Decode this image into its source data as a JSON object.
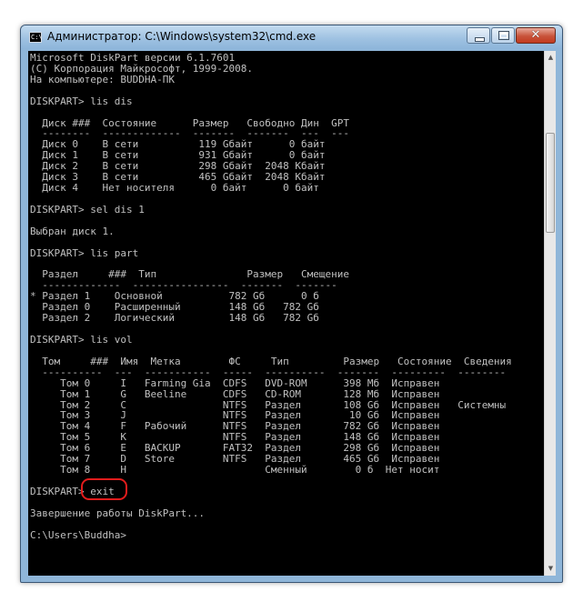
{
  "window": {
    "title": "Администратор: C:\\Windows\\system32\\cmd.exe",
    "close_glyph": "✕"
  },
  "console": {
    "lines": [
      "Microsoft DiskPart версии 6.1.7601",
      "(C) Корпорация Майкрософт, 1999-2008.",
      "На компьютере: BUDDHA-ПК",
      "",
      "DISKPART> lis dis",
      "",
      "  Диск ###  Состояние      Размер   Свободно Дин  GPT",
      "  --------  -------------  -------  -------  ---  ---",
      "  Диск 0    В сети          119 Gбайт      0 байт",
      "  Диск 1    В сети          931 Gбайт      0 байт",
      "  Диск 2    В сети          298 Gбайт  2048 Кбайт",
      "  Диск 3    В сети          465 Gбайт  2048 Кбайт",
      "  Диск 4    Нет носителя      0 байт      0 байт",
      "",
      "DISKPART> sel dis 1",
      "",
      "Выбран диск 1.",
      "",
      "DISKPART> lis part",
      "",
      "  Раздел     ###  Тип               Размер   Смещение",
      "  -------------  ----------------  -------  -------",
      "* Раздел 1    Основной           782 Gб      0 б",
      "  Раздел 0    Расширенный        148 Gб   782 Gб",
      "  Раздел 2    Логический         148 Gб   782 Gб",
      "",
      "DISKPART> lis vol",
      "",
      "  Том     ###  Имя  Метка        ФС     Тип         Размер   Состояние  Сведения",
      "  ----------  ---  -----------  -----  ----------  -------  ---------  --------",
      "     Том 0     I   Farming Gia  CDFS   DVD-ROM      398 Мб  Исправен",
      "     Том 1     G   Beeline      CDFS   CD-ROM       128 Мб  Исправен",
      "     Том 2     C                NTFS   Раздел       108 Gб  Исправен   Системны",
      "     Том 3     J                NTFS   Раздел        10 Gб  Исправен",
      "     Том 4     F   Рабочий      NTFS   Раздел       782 Gб  Исправен",
      "     Том 5     K                NTFS   Раздел       148 Gб  Исправен",
      "     Том 6     E   BACKUP       FAT32  Раздел       298 Gб  Исправен",
      "     Том 7     D   Store        NTFS   Раздел       465 Gб  Исправен",
      "     Том 8     H                       Сменный        0 б  Нет носит",
      "",
      "DISKPART> exit",
      "",
      "Завершение работы DiskPart...",
      "",
      "C:\\Users\\Buddha>"
    ]
  }
}
